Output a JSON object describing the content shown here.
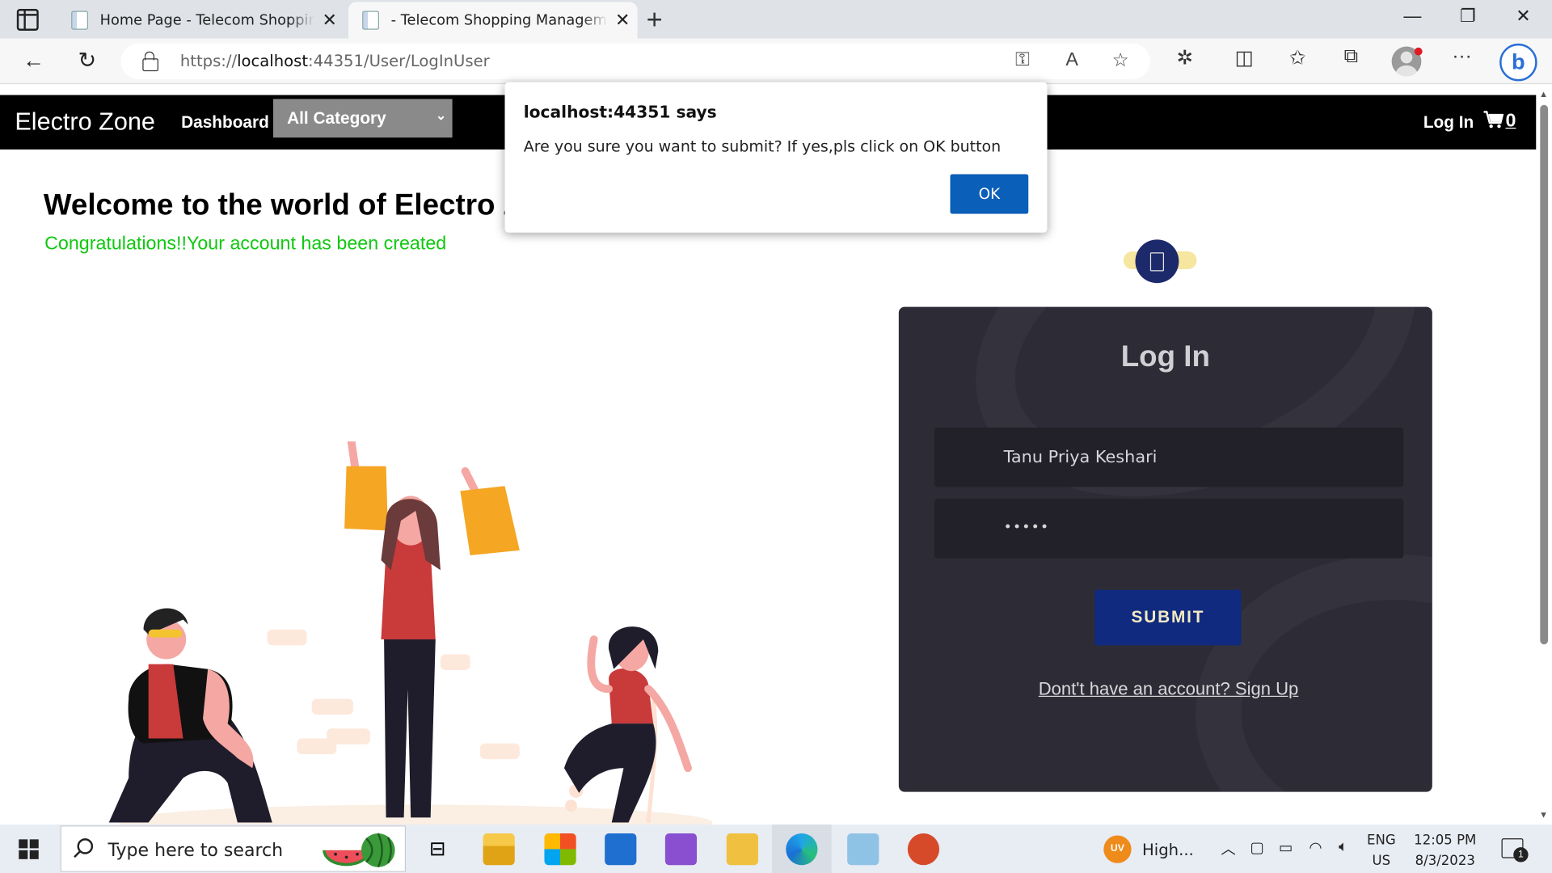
{
  "browser": {
    "tabs": [
      {
        "title": "Home Page - Telecom Shopping",
        "active": false
      },
      {
        "title": "- Telecom Shopping Management",
        "active": true
      }
    ],
    "url_prefix": "https://",
    "url_host": "localhost",
    "url_rest": ":44351/User/LogInUser"
  },
  "site": {
    "brand": "Electro Zone",
    "nav_dashboard": "Dashboard",
    "category_selected": "All Category",
    "login_link": "Log In",
    "cart_count": "0",
    "welcome": "Welcome to the world of Electro Z",
    "congrats": "Congratulations!!Your account has been created",
    "accent_green": "#10c810"
  },
  "login": {
    "title": "Log In",
    "username_value": "Tanu Priya Keshari",
    "password_value": "•••••",
    "submit_label": "SUBMIT",
    "signup_link": "Dont't have an account? Sign Up"
  },
  "dialog": {
    "title": "localhost:44351 says",
    "message": "Are you sure you want to submit? If yes,pls click on OK button",
    "ok_label": "OK"
  },
  "taskbar": {
    "search_placeholder": "Type here to search",
    "weather_badge": "UV",
    "weather_text": "High...",
    "lang_top": "ENG",
    "lang_bottom": "US",
    "time": "12:05 PM",
    "date": "8/3/2023",
    "notification_count": "1"
  }
}
